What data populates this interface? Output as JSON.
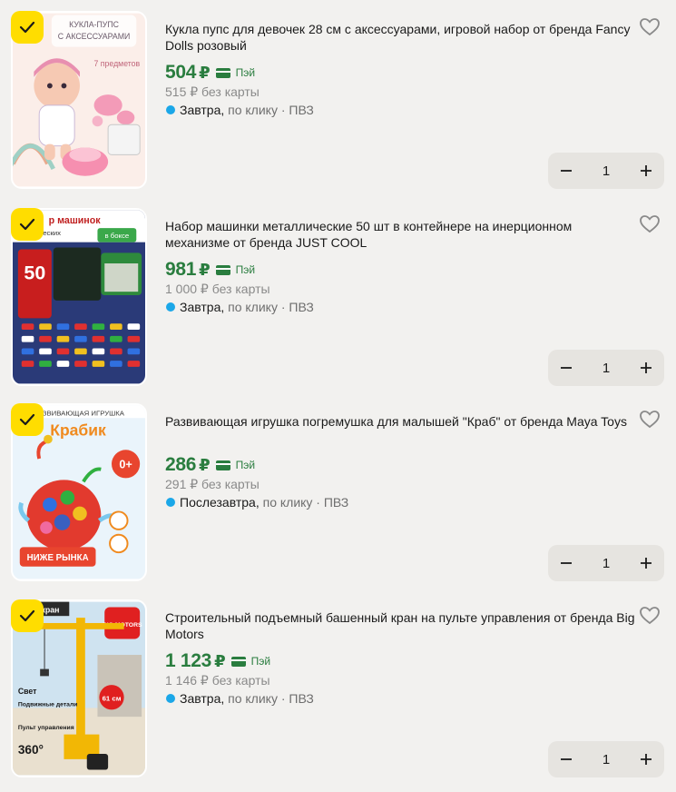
{
  "cart": {
    "items": [
      {
        "title": "Кукла пупс для девочек 28 см с аксессуарами, игровой набор от бренда Fancy Dolls розовый",
        "price": "504",
        "currency": "₽",
        "pay_label": "Пэй",
        "price_no_card": "515 ₽ без карты",
        "delivery_day": "Завтра,",
        "delivery_rest": " по клику · ПВЗ",
        "quantity": "1",
        "image_text": {
          "line1": "КУКЛА-ПУПС",
          "line2": "С АКСЕССУАРАМИ",
          "badge": "7 предметов"
        },
        "checked": true
      },
      {
        "title": "Набор машинки металлические 50 шт в контейнере на инерционном механизме от бренда JUST COOL",
        "price": "981",
        "currency": "₽",
        "pay_label": "Пэй",
        "price_no_card": "1 000 ₽ без карты",
        "delivery_day": "Завтра,",
        "delivery_rest": " по клику · ПВЗ",
        "quantity": "1",
        "image_text": {
          "line1": "р машинок",
          "line2": "ических",
          "badge": "50",
          "badge2": "в боксе"
        },
        "checked": true
      },
      {
        "title": "Развивающая игрушка погремушка для малышей \"Краб\" от бренда Maya Toys",
        "price": "286",
        "currency": "₽",
        "pay_label": "Пэй",
        "price_no_card": "291 ₽ без карты",
        "delivery_day": "Послезавтра,",
        "delivery_rest": " по клику · ПВЗ",
        "quantity": "1",
        "image_text": {
          "line1": "РАЗВИВАЮЩАЯ ИГРУШКА",
          "line2": "Крабик",
          "badge": "0+",
          "banner": "НИЖЕ РЫНКА"
        },
        "checked": true
      },
      {
        "title": "Строительный подъемный башенный кран на пульте управления от бренда Big Motors",
        "price": "1 123",
        "currency": "₽",
        "pay_label": "Пэй",
        "price_no_card": "1 146 ₽ без карты",
        "delivery_day": "Завтра,",
        "delivery_rest": " по клику · ПВЗ",
        "quantity": "1",
        "image_text": {
          "line1": "ный кран",
          "logo": "BIG MOTORS",
          "f1": "Свет",
          "f2": "Подвижные детали",
          "f3": "Пульт управления",
          "f4": "360°",
          "badge": "61 см"
        },
        "checked": true
      }
    ],
    "icons": {
      "check": "checkmark-icon",
      "favorite": "heart-outline-icon",
      "minus": "minus-icon",
      "plus": "plus-icon",
      "pay": "card-icon"
    },
    "colors": {
      "accent_yellow": "#ffdd00",
      "price_green": "#2a7d3f",
      "delivery_dot": "#1ba7e8",
      "background": "#f2f1ef"
    }
  }
}
